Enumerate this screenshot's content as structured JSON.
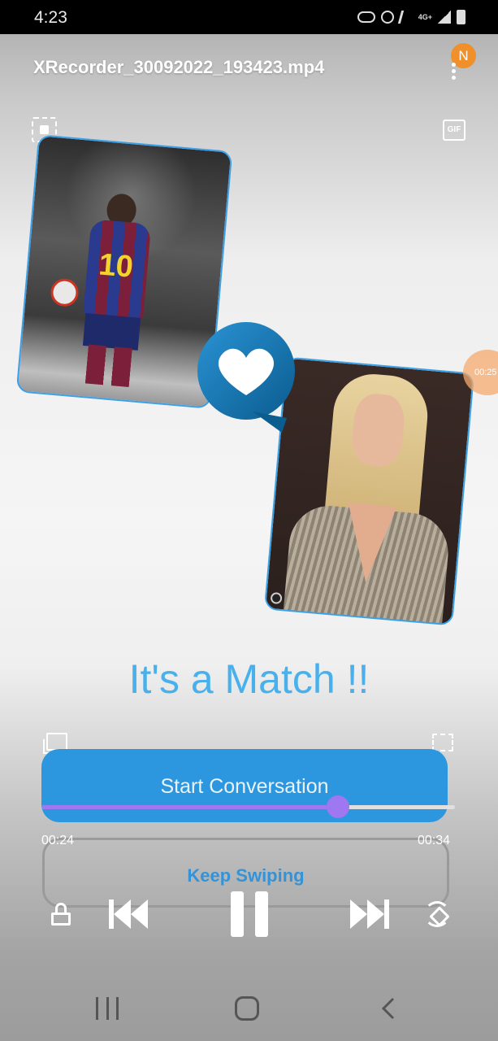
{
  "status_bar": {
    "time": "4:23",
    "network_label": "4G+",
    "icons": [
      "vpn-key-icon",
      "alarm-icon",
      "mute-icon",
      "wifi-icon",
      "signal-icon",
      "battery-icon"
    ]
  },
  "header": {
    "file_name": "XRecorder_30092022_193423.mp4",
    "avatar_letter": "N",
    "menu_icon": "more-vertical-icon"
  },
  "toolbar": {
    "screenshot_icon": "screenshot-icon",
    "gif_label": "GIF"
  },
  "floating_bubble": {
    "time": "00:25"
  },
  "main": {
    "match_title": "It's a Match !!",
    "start_button_label": "Start Conversation",
    "keep_button_label": "Keep Swiping"
  },
  "player": {
    "current_time": "00:24",
    "total_time": "00:34",
    "progress_fraction": 0.716
  },
  "colors": {
    "accent_blue": "#2c97df",
    "title_blue": "#4ab0ec",
    "seek_purple": "#9f77f0",
    "avatar_orange": "#f0902a"
  }
}
